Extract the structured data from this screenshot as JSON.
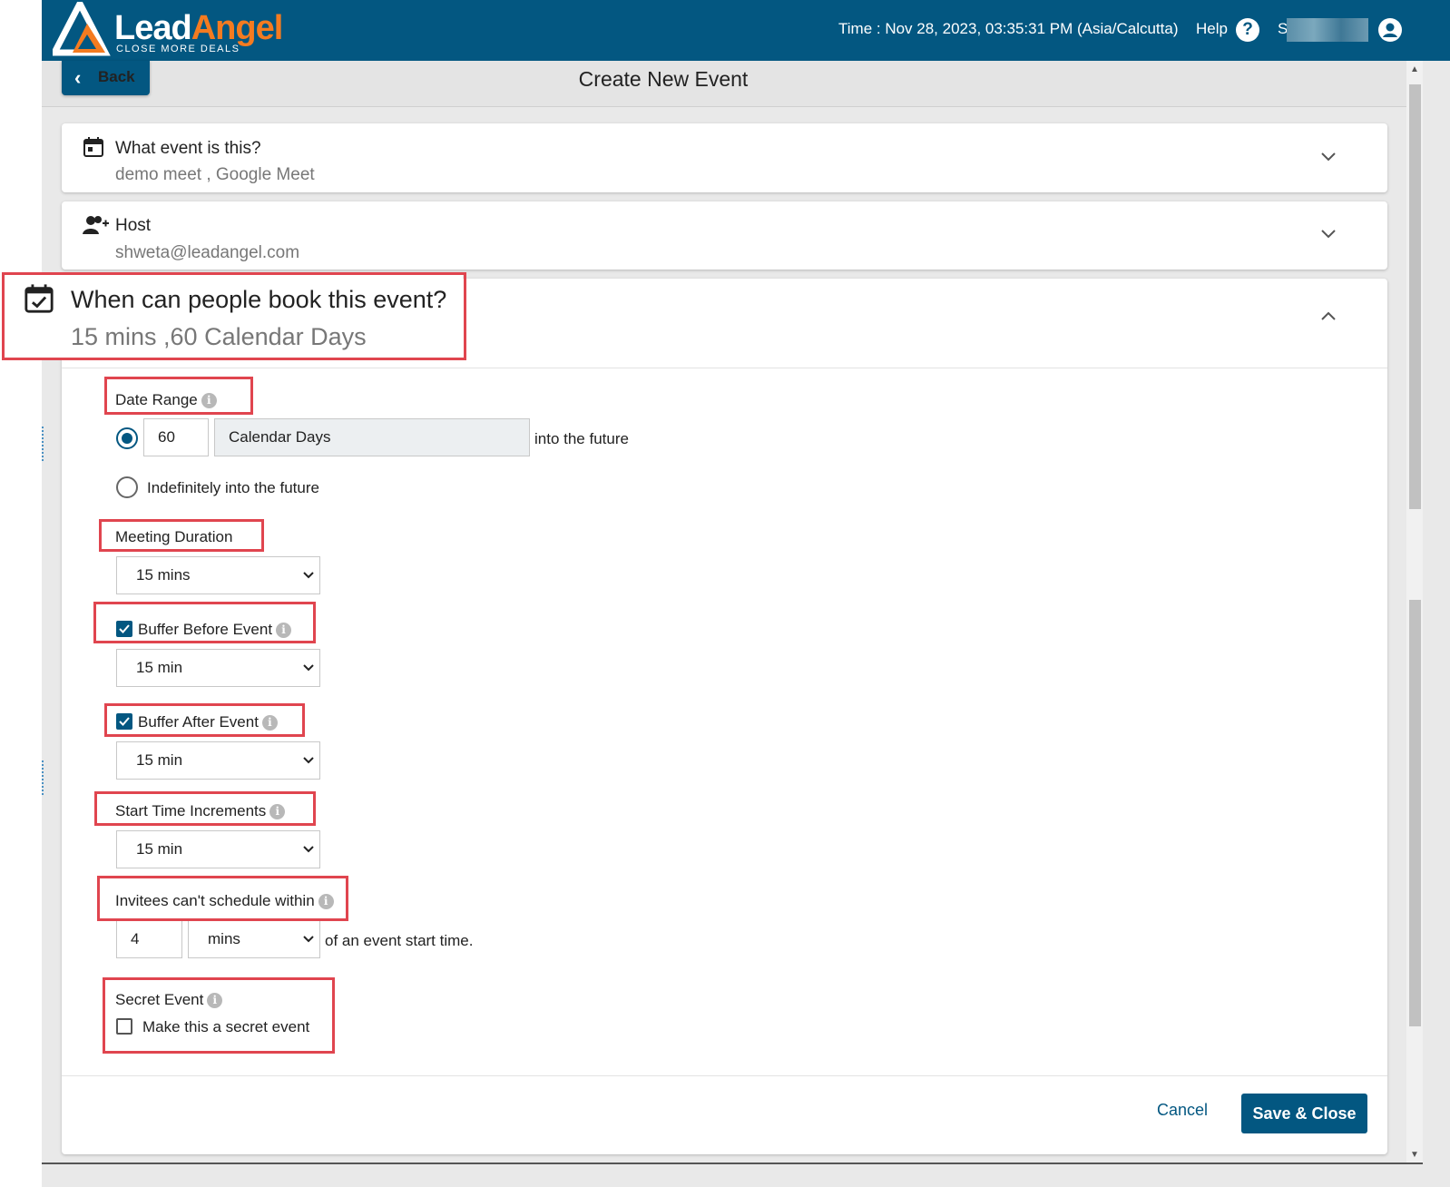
{
  "header": {
    "brand_part1": "Lead",
    "brand_part2": "Angel",
    "tagline": "CLOSE MORE DEALS",
    "time": "Time : Nov 28, 2023, 03:35:31 PM (Asia/Calcutta)",
    "help_label": "Help",
    "help_glyph": "?",
    "user_initial": "S"
  },
  "subheader": {
    "back_label": "Back",
    "title": "Create New Event"
  },
  "cards": {
    "event": {
      "title": "What event is this?",
      "summary": "demo meet , Google Meet",
      "icon": "calendar-icon"
    },
    "host": {
      "title": "Host",
      "summary": "shweta@leadangel.com",
      "icon": "add-person-icon"
    },
    "booking": {
      "title": "When can people book this event?",
      "summary": "15 mins ,60 Calendar Days",
      "icon": "calendar-check-icon"
    }
  },
  "form": {
    "date_range": {
      "label": "Date Range",
      "days_value": "60",
      "unit_value": "Calendar Days",
      "suffix": "into the future",
      "indefinite_label": "Indefinitely into the future",
      "selected": "days"
    },
    "meeting_duration": {
      "label": "Meeting Duration",
      "value": "15 mins"
    },
    "buffer_before": {
      "label": "Buffer Before Event",
      "checked": true,
      "value": "15 min"
    },
    "buffer_after": {
      "label": "Buffer After Event",
      "checked": true,
      "value": "15 min"
    },
    "start_increments": {
      "label": "Start Time Increments",
      "value": "15 min"
    },
    "invitee_limit": {
      "label": "Invitees can't schedule within",
      "amount": "4",
      "unit": "mins",
      "suffix": "of an event start time."
    },
    "secret_event": {
      "label": "Secret Event",
      "checkbox_label": "Make this a secret event",
      "checked": false
    },
    "info_glyph": "i"
  },
  "footer": {
    "cancel_label": "Cancel",
    "save_label": "Save & Close"
  },
  "colors": {
    "brand_blue": "#035781",
    "brand_orange": "#f47b20",
    "highlight_red": "#e0454f"
  }
}
